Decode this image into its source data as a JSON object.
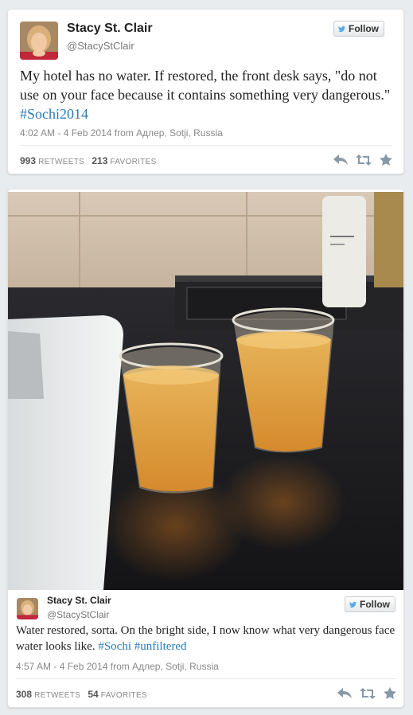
{
  "tweets": [
    {
      "name": "Stacy St. Clair",
      "handle": "@StacyStClair",
      "follow_label": "Follow",
      "text_parts": [
        "My hotel has no water. If restored, the front desk says, \"do not use on your face because it contains something very dangerous.\" ",
        "#Sochi2014"
      ],
      "timestamp": "4:02 AM - 4 Feb 2014 from Адлер, Sotji, Russia",
      "retweets_count": "993",
      "retweets_label": "RETWEETS",
      "favorites_count": "213",
      "favorites_label": "FAVORITES"
    },
    {
      "name": "Stacy St. Clair",
      "handle": "@StacyStClair",
      "follow_label": "Follow",
      "text_parts": [
        "Water restored, sorta. On the bright side, I now know what very dangerous face water looks like. ",
        "#Sochi",
        " ",
        "#unfiltered"
      ],
      "timestamp": "4:57 AM - 4 Feb 2014 from Адлер, Sotji, Russia",
      "retweets_count": "308",
      "retweets_label": "RETWEETS",
      "favorites_count": "54",
      "favorites_label": "FAVORITES"
    }
  ],
  "icons": {
    "follow": "twitter-bird-icon",
    "reply": "reply-icon",
    "retweet": "retweet-icon",
    "favorite": "star-icon"
  },
  "colors": {
    "hashtag": "#2b7bb9",
    "background": "#e9ecee",
    "twitter_blue": "#55acee"
  }
}
